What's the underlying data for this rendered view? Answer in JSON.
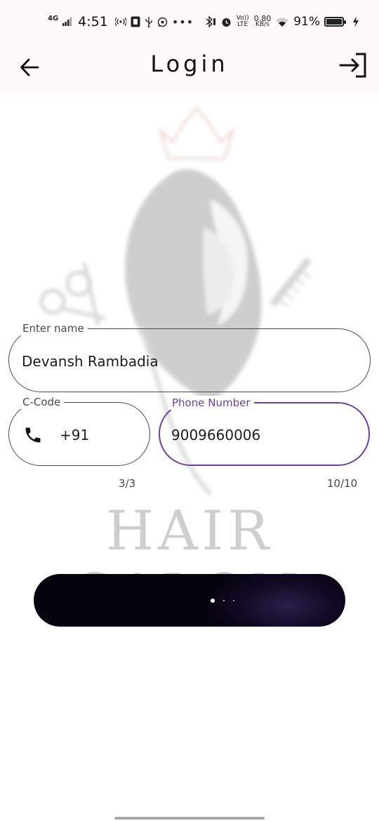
{
  "status_bar": {
    "network": "4G",
    "time": "4:51",
    "volte": "Vo)) LTE",
    "speed_value": "0.80",
    "speed_unit": "KB/s",
    "battery": "91%",
    "battery_level": 0.91
  },
  "app_bar": {
    "title": "Login"
  },
  "background": {
    "logo_text": "HAIR SALON"
  },
  "form": {
    "name": {
      "label": "Enter name",
      "value": "Devansh Rambadia"
    },
    "country_code": {
      "label": "C-Code",
      "value": "+91",
      "counter": "3/3"
    },
    "phone": {
      "label": "Phone Number",
      "value": "9009660006",
      "counter": "10/10"
    }
  },
  "colors": {
    "focus_accent": "#6b3fa6",
    "button_background": "#0b0618",
    "appbar_background": "#fdf8fc"
  }
}
